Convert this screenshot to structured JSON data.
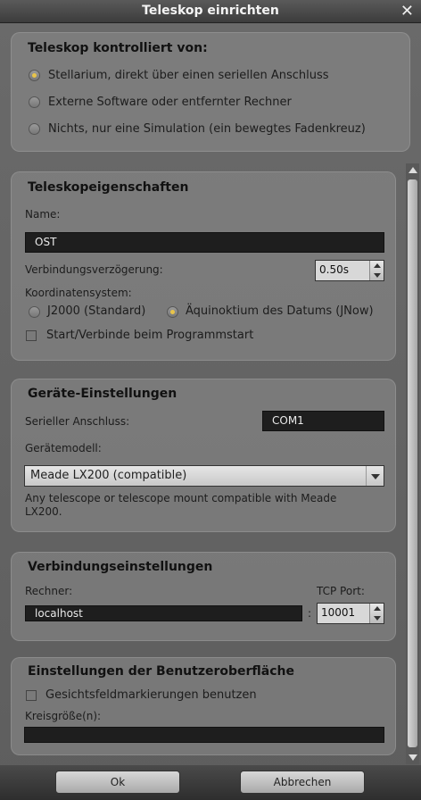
{
  "window": {
    "title": "Teleskop einrichten"
  },
  "control": {
    "heading": "Teleskop kontrolliert von:",
    "options": [
      "Stellarium, direkt über einen seriellen Anschluss",
      "Externe Software oder entfernter Rechner",
      "Nichts, nur eine Simulation (ein bewegtes Fadenkreuz)"
    ],
    "selected_index": 0
  },
  "properties": {
    "heading": "Teleskopeigenschaften",
    "name_label": "Name:",
    "name_value": "OST",
    "delay_label": "Verbindungsverzögerung:",
    "delay_value": "0.50s",
    "coord_label": "Koordinatensystem:",
    "coord_options": [
      "J2000 (Standard)",
      "Äquinoktium des Datums (JNow)"
    ],
    "coord_selected_index": 1,
    "autostart_label": "Start/Verbinde beim Programmstart",
    "autostart_checked": false
  },
  "device": {
    "heading": "Geräte-Einstellungen",
    "serial_label": "Serieller Anschluss:",
    "serial_value": "COM1",
    "model_label": "Gerätemodell:",
    "model_value": "Meade LX200 (compatible)",
    "model_desc": "Any telescope or telescope mount compatible with Meade LX200."
  },
  "connection": {
    "heading": "Verbindungseinstellungen",
    "host_label": "Rechner:",
    "host_value": "localhost",
    "port_label": "TCP Port:",
    "port_separator": ":",
    "port_value": "10001"
  },
  "ui": {
    "heading": "Einstellungen der Benutzeroberfläche",
    "fov_label": "Gesichtsfeldmarkierungen benutzen",
    "fov_checked": false,
    "circle_label": "Kreisgröße(n):",
    "circle_value": ""
  },
  "buttons": {
    "ok": "Ok",
    "cancel": "Abbrechen"
  },
  "colors": {
    "accent_radio": "#e8c44a",
    "field_bg": "#1e1e1e"
  }
}
